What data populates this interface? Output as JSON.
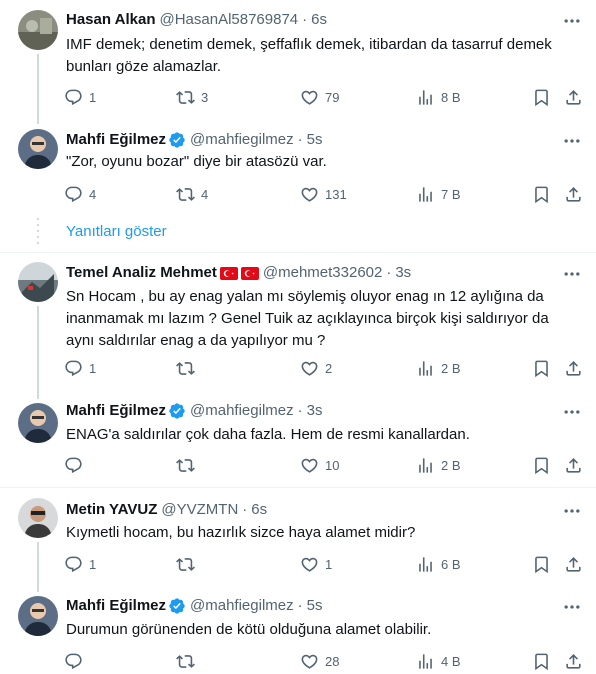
{
  "colors": {
    "accent": "#1d9bf0",
    "secondary_text": "#536471",
    "thread_line": "#cfd9de",
    "divider": "#eff3f4"
  },
  "tweets": [
    {
      "name": "Hasan Alkan",
      "handle": "@HasanAl58769874",
      "time": "6s",
      "text": "IMF demek; denetim demek, şeffaflık demek, itibardan da tasarruf demek\nbunları göze alamazlar.",
      "replies": "1",
      "retweets": "3",
      "likes": "79",
      "views": "8 B"
    },
    {
      "name": "Mahfi Eğilmez",
      "handle": "@mahfiegilmez",
      "time": "5s",
      "verified": true,
      "text": "\"Zor, oyunu bozar\" diye bir atasözü var.",
      "replies": "4",
      "retweets": "4",
      "likes": "131",
      "views": "7 B"
    },
    {
      "name": "Temel Analiz Mehmet",
      "handle": "@mehmet332602",
      "time": "3s",
      "text": "Sn Hocam , bu ay enag yalan mı söylemiş oluyor enag ın 12 aylığına da\ninanmamak mı lazım ? Genel Tuik az açıklayınca birçok kişi saldırıyor da\naynı saldırılar enag a da yapılıyor mu ?",
      "replies": "1",
      "retweets": "",
      "likes": "2",
      "views": "2 B"
    },
    {
      "name": "Mahfi Eğilmez",
      "handle": "@mahfiegilmez",
      "time": "3s",
      "verified": true,
      "text": "ENAG'a saldırılar çok daha fazla. Hem de resmi kanallardan.",
      "replies": "",
      "retweets": "",
      "likes": "10",
      "views": "2 B"
    },
    {
      "name": "Metin YAVUZ",
      "handle": "@YVZMTN",
      "time": "6s",
      "text": "Kıymetli hocam, bu hazırlık sizce haya alamet midir?",
      "replies": "1",
      "retweets": "",
      "likes": "1",
      "views": "6 B"
    },
    {
      "name": "Mahfi Eğilmez",
      "handle": "@mahfiegilmez",
      "time": "5s",
      "verified": true,
      "text": "Durumun görünenden de kötü olduğuna alamet olabilir.",
      "replies": "",
      "retweets": "",
      "likes": "28",
      "views": "4 B"
    }
  ],
  "show_replies_label": "Yanıtları göster",
  "icons": {
    "reply": "reply-icon",
    "retweet": "retweet-icon",
    "like": "heart-icon",
    "views": "views-icon",
    "bookmark": "bookmark-icon",
    "share": "share-icon",
    "more": "more-icon",
    "verified": "verified-badge-icon",
    "flag": "turkey-flag-icon"
  }
}
